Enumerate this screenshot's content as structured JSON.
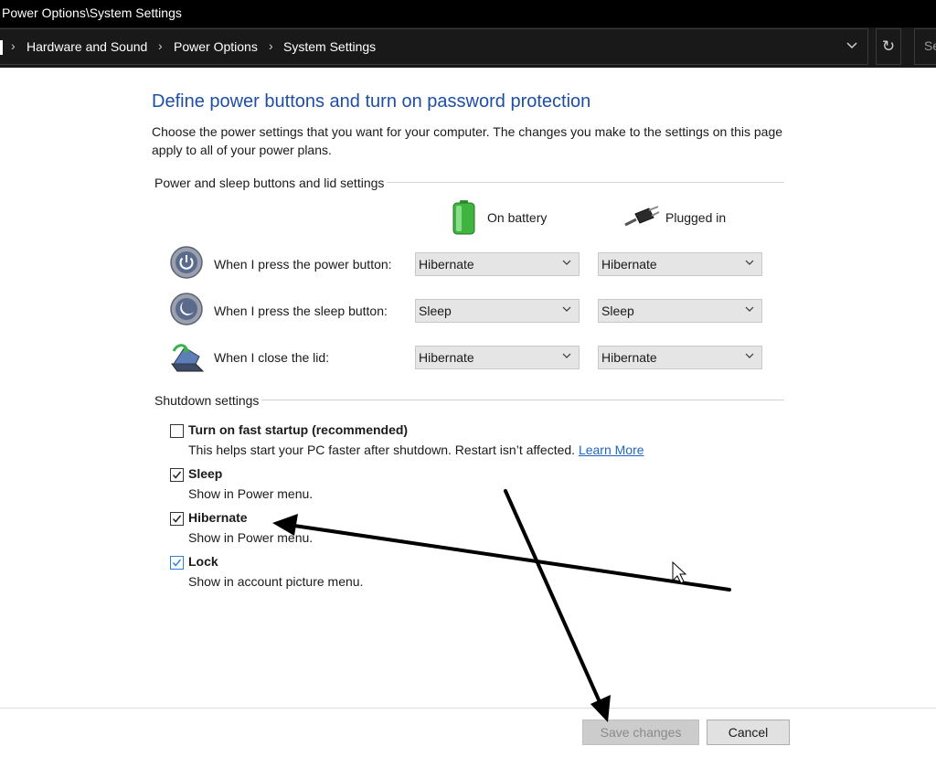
{
  "window": {
    "title": "Power Options\\System Settings"
  },
  "address_bar": {
    "breadcrumbs": [
      "Hardware and Sound",
      "Power Options",
      "System Settings"
    ],
    "search_placeholder": "Se"
  },
  "page": {
    "heading": "Define power buttons and turn on password protection",
    "description": "Choose the power settings that you want for your computer. The changes you make to the settings on this page apply to all of your power plans."
  },
  "buttons_section": {
    "label": "Power and sleep buttons and lid settings",
    "columns": {
      "battery": "On battery",
      "plugged": "Plugged in"
    },
    "rows": [
      {
        "label": "When I press the power button:",
        "battery": "Hibernate",
        "plugged": "Hibernate"
      },
      {
        "label": "When I press the sleep button:",
        "battery": "Sleep",
        "plugged": "Sleep"
      },
      {
        "label": "When I close the lid:",
        "battery": "Hibernate",
        "plugged": "Hibernate"
      }
    ]
  },
  "shutdown_section": {
    "label": "Shutdown settings",
    "options": [
      {
        "label": "Turn on fast startup (recommended)",
        "desc": "This helps start your PC faster after shutdown. Restart isn’t affected.",
        "link": "Learn More",
        "checked": false
      },
      {
        "label": "Sleep",
        "desc": "Show in Power menu.",
        "checked": true
      },
      {
        "label": "Hibernate",
        "desc": "Show in Power menu.",
        "checked": true
      },
      {
        "label": "Lock",
        "desc": "Show in account picture menu.",
        "checked": true
      }
    ]
  },
  "footer": {
    "save_label": "Save changes",
    "cancel_label": "Cancel"
  },
  "colors": {
    "heading": "#1e4ea3",
    "link": "#1f66c1",
    "checkbox_blue": "#2f7fd6"
  }
}
